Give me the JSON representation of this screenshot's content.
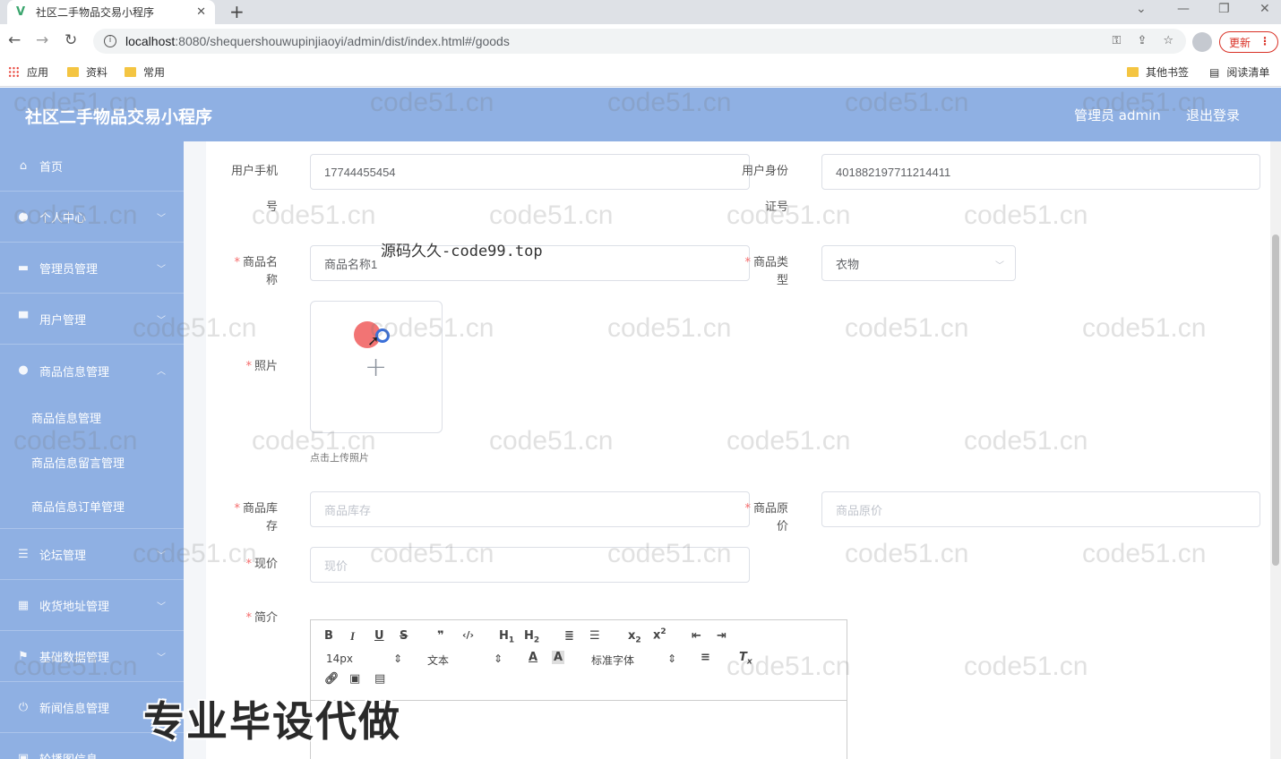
{
  "browser": {
    "tab_title": "社区二手物品交易小程序",
    "tab_close": "✕",
    "new_tab": "+",
    "url_host": "localhost",
    "url_rest": ":8080/shequershouwupinjiaoyi/admin/dist/index.html#/goods",
    "update_label": "更新",
    "bookmarks": [
      "应用",
      "资料",
      "常用"
    ],
    "other_bookmarks": "其他书签",
    "reading_list": "阅读清单"
  },
  "header": {
    "brand": "社区二手物品交易小程序",
    "user": "管理员 admin",
    "logout": "退出登录"
  },
  "sidebar": {
    "items": [
      {
        "label": "首页",
        "icon": "home-icon"
      },
      {
        "label": "个人中心",
        "icon": "user-icon"
      },
      {
        "label": "管理员管理",
        "icon": "briefcase-icon"
      },
      {
        "label": "用户管理",
        "icon": "users-icon"
      },
      {
        "label": "商品信息管理",
        "icon": "user-icon"
      },
      {
        "label": "论坛管理",
        "icon": "list-icon"
      },
      {
        "label": "收货地址管理",
        "icon": "grid-icon"
      },
      {
        "label": "基础数据管理",
        "icon": "flag-icon"
      },
      {
        "label": "新闻信息管理",
        "icon": "power-icon"
      },
      {
        "label": "轮播图信息",
        "icon": "image-icon"
      }
    ],
    "sub_items": [
      "商品信息管理",
      "商品信息留言管理",
      "商品信息订单管理"
    ]
  },
  "form": {
    "phone_label_1": "用户手机",
    "phone_label_2": "号",
    "phone_value": "17744455454",
    "idcard_label_1": "用户身份",
    "idcard_label_2": "证号",
    "idcard_value": "401882197711214411",
    "name_label": "商品名称",
    "name_value": "商品名称1",
    "type_label": "商品类型",
    "type_value": "衣物",
    "photo_label": "照片",
    "upload_tip": "点击上传照片",
    "stock_label": "商品库存",
    "stock_placeholder": "商品库存",
    "orig_price_label": "商品原价",
    "orig_price_placeholder": "商品原价",
    "price_label": "现价",
    "price_placeholder": "现价",
    "intro_label": "简介",
    "required_mark": "*"
  },
  "editor": {
    "font_size": "14px",
    "block_type": "文本",
    "font_family": "标准字体"
  },
  "overlay": {
    "center_text": "源码久久-code99.top",
    "watermark": "code51.cn",
    "big_text": "专业毕设代做"
  }
}
